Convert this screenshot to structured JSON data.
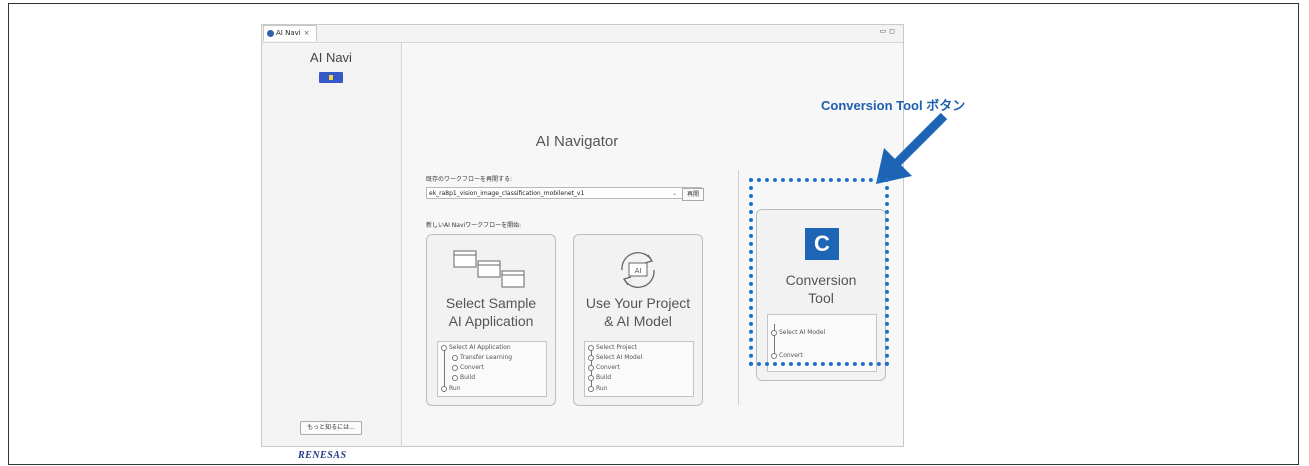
{
  "tab": {
    "label": "AI Navi",
    "close": "×"
  },
  "window_controls": {
    "minimize": "▭",
    "maximize": "◻"
  },
  "sidebar": {
    "title": "AI Navi",
    "more_button": "もっと知るには...",
    "logo": "RENESAS"
  },
  "main": {
    "title": "AI Navigator",
    "resume_label": "既存のワークフローを再開する:",
    "workflow_select": {
      "value": "ek_ra8p1_vision_image_classification_mobilenet_v1",
      "chevron": "⌄"
    },
    "resume_button": "再開",
    "new_label": "新しいAI Naviワークフローを開始:"
  },
  "cards": [
    {
      "title_line1": "Select Sample",
      "title_line2": "AI Application",
      "steps": [
        "Select AI Application",
        "Transfer Learning",
        "Convert",
        "Build",
        "Run"
      ]
    },
    {
      "title_line1": "Use Your Project",
      "title_line2": "& AI Model",
      "steps": [
        "Select Project",
        "Select AI Model",
        "Convert",
        "Build",
        "Run"
      ]
    },
    {
      "badge": "C",
      "title_line1": "Conversion",
      "title_line2": "Tool",
      "steps": [
        "Select AI Model",
        "Convert"
      ]
    }
  ],
  "annotation": {
    "text": "Conversion Tool  ボタン",
    "color": "#1f5fae"
  }
}
